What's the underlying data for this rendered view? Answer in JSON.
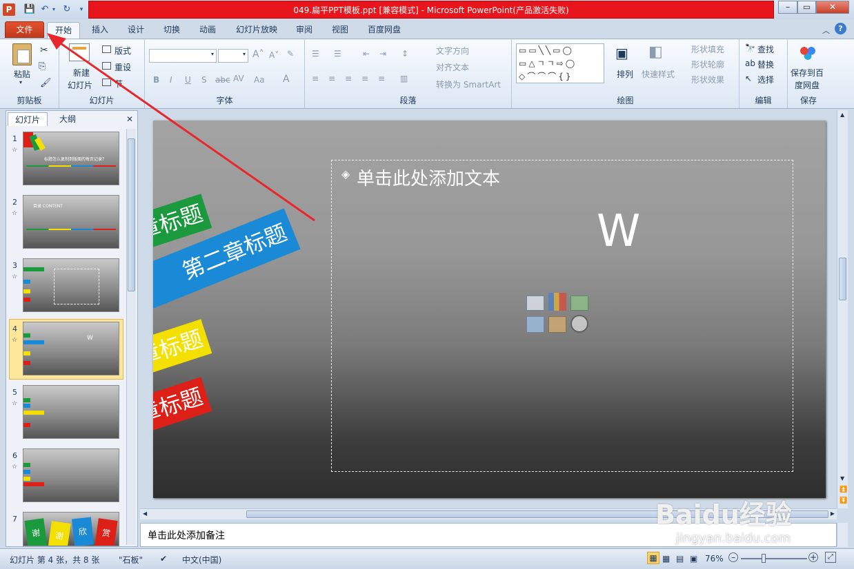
{
  "window": {
    "title": "049.扁平PPT模板.ppt [兼容模式] - Microsoft PowerPoint(产品激活失败)"
  },
  "tabs": [
    "文件",
    "开始",
    "插入",
    "设计",
    "切换",
    "动画",
    "幻灯片放映",
    "审阅",
    "视图",
    "百度网盘"
  ],
  "ribbon": {
    "clipboard": {
      "paste": "粘贴",
      "label": "剪贴板"
    },
    "slides": {
      "new_slide_line1": "新建",
      "new_slide_line2": "幻灯片",
      "layout": "版式",
      "reset": "重设",
      "section": "节",
      "label": "幻灯片"
    },
    "font": {
      "label": "字体"
    },
    "paragraph": {
      "text_direction": "文字方向",
      "align_text": "对齐文本",
      "convert_smartart": "转换为 SmartArt",
      "label": "段落"
    },
    "drawing": {
      "arrange": "排列",
      "quick_styles": "快速样式",
      "shape_fill": "形状填充",
      "shape_outline": "形状轮廓",
      "shape_effects": "形状效果",
      "label": "绘图"
    },
    "editing": {
      "find": "查找",
      "replace": "替换",
      "select": "选择",
      "label": "编辑"
    },
    "save": {
      "line1": "保存到百",
      "line2": "度网盘",
      "label": "保存"
    }
  },
  "panel": {
    "tab_slides": "幻灯片",
    "tab_outline": "大纲",
    "close": "✕"
  },
  "thumbnails": [
    "1",
    "2",
    "3",
    "4",
    "5",
    "6",
    "7"
  ],
  "thumb_texts": {
    "t1": "标题怎么复制到版面的每页记录？",
    "t2": "目录 CONTENT",
    "t7": [
      "谢",
      "谢",
      "欣",
      "赏"
    ]
  },
  "slide": {
    "placeholder": "单击此处添加文本",
    "letter": "W",
    "ribbons": [
      "章标题",
      "第二章标题",
      "章标题",
      "章标题"
    ],
    "colors": {
      "green": "#1a9a3c",
      "blue": "#1a8ad6",
      "yellow": "#f4e000",
      "red": "#dc2018"
    }
  },
  "notes": {
    "placeholder": "单击此处添加备注"
  },
  "status": {
    "slide_info": "幻灯片 第 4 张，共 8 张",
    "theme": "\"石板\"",
    "language": "中文(中国)",
    "zoom": "76%"
  },
  "watermark": {
    "brand": "Baidu经验",
    "url": "jingyan.baidu.com"
  }
}
